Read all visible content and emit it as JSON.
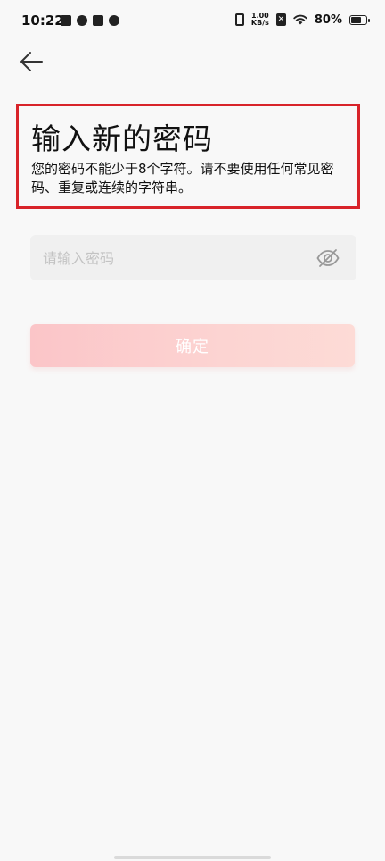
{
  "status_bar": {
    "time": "10:22",
    "net_speed_value": "1.00",
    "net_speed_unit": "KB/s",
    "sim_label": "✕",
    "battery_percent": "80%",
    "battery_level": 0.8
  },
  "header": {
    "title": "输入新的密码",
    "subtitle": "您的密码不能少于8个字符。请不要使用任何常见密码、重复或连续的字符串。"
  },
  "form": {
    "password_placeholder": "请输入密码",
    "password_value": "",
    "confirm_label": "确定"
  },
  "colors": {
    "highlight_border": "#d8232a",
    "button_gradient_start": "#fbc5c8",
    "button_gradient_end": "#fddbd6",
    "background": "#f8f8f8"
  },
  "icons": {
    "back": "back-arrow-icon",
    "password_toggle": "eye-hidden-icon"
  }
}
